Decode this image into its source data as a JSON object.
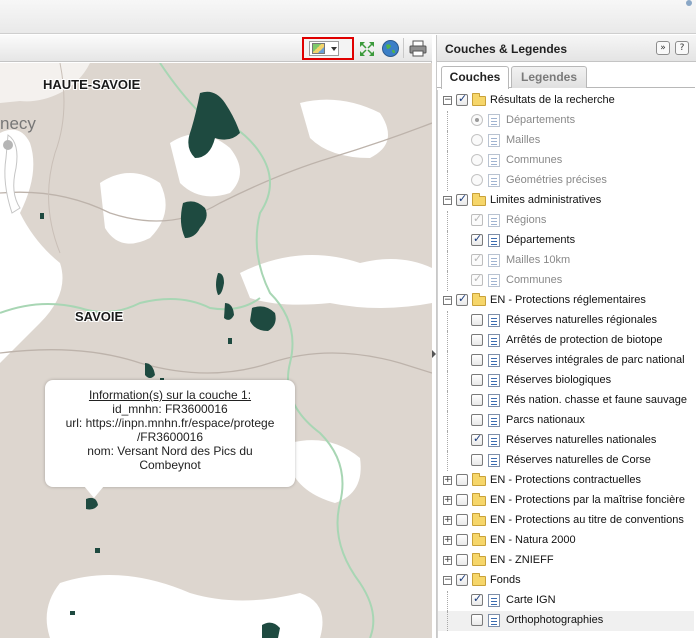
{
  "map": {
    "labels": {
      "haute_savoie": "HAUTE-SAVOIE",
      "savoie": "SAVOIE",
      "city": "necy"
    },
    "popup": {
      "title": "Information(s) sur la couche 1:",
      "id_line": "id_mnhn: FR3600016",
      "url_line1": "url: https://inpn.mnhn.fr/espace/protege",
      "url_line2": "/FR3600016",
      "nom_line1": "nom: Versant Nord des Pics du",
      "nom_line2": "Combeynot"
    },
    "colors": {
      "land": "#ddd6cf",
      "background": "#ffffff",
      "protected_area": "#1e4a40",
      "border": "#a8d6b4",
      "road": "#bdb3ab"
    }
  },
  "toolbar": {
    "icons": [
      "layer-switcher-icon",
      "zoom-extent-icon",
      "globe-icon",
      "print-icon"
    ],
    "highlight_color": "#e00000"
  },
  "panel": {
    "title": "Couches & Legendes",
    "collapse_symbol": "»",
    "help_symbol": "?",
    "tabs": [
      {
        "label": "Couches",
        "active": true
      },
      {
        "label": "Legendes",
        "active": false
      }
    ],
    "tree": [
      {
        "level": 0,
        "type": "group",
        "expanded": true,
        "checked": true,
        "dim": false,
        "label": "Résultats de la recherche"
      },
      {
        "level": 1,
        "type": "radio",
        "selected": true,
        "dim": true,
        "label": "Départements"
      },
      {
        "level": 1,
        "type": "radio",
        "selected": false,
        "dim": true,
        "label": "Mailles"
      },
      {
        "level": 1,
        "type": "radio",
        "selected": false,
        "dim": true,
        "label": "Communes"
      },
      {
        "level": 1,
        "type": "radio",
        "selected": false,
        "dim": true,
        "label": "Géométries précises"
      },
      {
        "level": 0,
        "type": "group",
        "expanded": true,
        "checked": true,
        "dim": false,
        "label": "Limites administratives"
      },
      {
        "level": 1,
        "type": "layer",
        "checked": true,
        "dim": true,
        "label": "Régions"
      },
      {
        "level": 1,
        "type": "layer",
        "checked": true,
        "dim": false,
        "label": "Départements"
      },
      {
        "level": 1,
        "type": "layer",
        "checked": true,
        "dim": true,
        "label": "Mailles 10km"
      },
      {
        "level": 1,
        "type": "layer",
        "checked": true,
        "dim": true,
        "label": "Communes"
      },
      {
        "level": 0,
        "type": "group",
        "expanded": true,
        "checked": true,
        "dim": false,
        "label": "EN - Protections réglementaires"
      },
      {
        "level": 1,
        "type": "layer",
        "checked": false,
        "dim": false,
        "label": "Réserves naturelles régionales"
      },
      {
        "level": 1,
        "type": "layer",
        "checked": false,
        "dim": false,
        "label": "Arrêtés de protection de biotope"
      },
      {
        "level": 1,
        "type": "layer",
        "checked": false,
        "dim": false,
        "label": "Réserves intégrales de parc national"
      },
      {
        "level": 1,
        "type": "layer",
        "checked": false,
        "dim": false,
        "label": "Réserves biologiques"
      },
      {
        "level": 1,
        "type": "layer",
        "checked": false,
        "dim": false,
        "label": "Rés nation. chasse et faune sauvage"
      },
      {
        "level": 1,
        "type": "layer",
        "checked": false,
        "dim": false,
        "label": "Parcs nationaux"
      },
      {
        "level": 1,
        "type": "layer",
        "checked": true,
        "dim": false,
        "label": "Réserves naturelles nationales"
      },
      {
        "level": 1,
        "type": "layer",
        "checked": false,
        "dim": false,
        "label": "Réserves naturelles de Corse"
      },
      {
        "level": 0,
        "type": "group",
        "expanded": false,
        "checked": false,
        "dim": false,
        "label": "EN - Protections contractuelles"
      },
      {
        "level": 0,
        "type": "group",
        "expanded": false,
        "checked": false,
        "dim": false,
        "label": "EN - Protections par la maîtrise foncière"
      },
      {
        "level": 0,
        "type": "group",
        "expanded": false,
        "checked": false,
        "dim": false,
        "label": "EN - Protections au titre de conventions"
      },
      {
        "level": 0,
        "type": "group",
        "expanded": false,
        "checked": false,
        "dim": false,
        "label": "EN - Natura 2000"
      },
      {
        "level": 0,
        "type": "group",
        "expanded": false,
        "checked": false,
        "dim": false,
        "label": "EN - ZNIEFF"
      },
      {
        "level": 0,
        "type": "group",
        "expanded": true,
        "checked": true,
        "dim": false,
        "label": "Fonds"
      },
      {
        "level": 1,
        "type": "layer",
        "checked": true,
        "dim": false,
        "label": "Carte IGN"
      },
      {
        "level": 1,
        "type": "layer",
        "checked": false,
        "dim": false,
        "label": "Orthophotographies",
        "highlight": true
      }
    ]
  }
}
